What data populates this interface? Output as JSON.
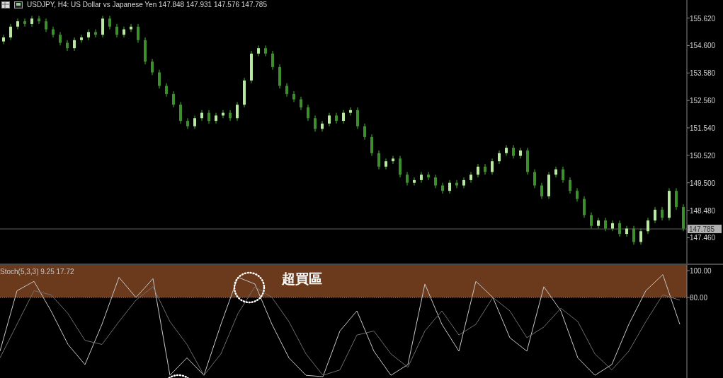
{
  "chart_window": {
    "symbol_info": "USDJPY, H4:  US Dollar vs Japanese Yen  147.848 147.931 147.576 147.785"
  },
  "price_chart": {
    "chart_data": {
      "type": "candlestick",
      "ylim": [
        146.5,
        156.29
      ],
      "yticks": [
        {
          "value": 155.62,
          "label": "155.620"
        },
        {
          "value": 154.6,
          "label": "154.600"
        },
        {
          "value": 153.58,
          "label": "153.580"
        },
        {
          "value": 152.56,
          "label": "152.560"
        },
        {
          "value": 151.54,
          "label": "151.540"
        },
        {
          "value": 150.52,
          "label": "150.520"
        },
        {
          "value": 149.5,
          "label": "149.500"
        },
        {
          "value": 148.48,
          "label": "148.480"
        },
        {
          "value": 147.46,
          "label": "147.460"
        }
      ],
      "ref_lines": [
        {
          "axis": "y",
          "value": 147.785,
          "label": "147.785"
        }
      ],
      "ohlc": [
        [
          154.75,
          155.0,
          154.65,
          154.9
        ],
        [
          154.9,
          155.4,
          154.8,
          155.3
        ],
        [
          155.3,
          155.6,
          155.2,
          155.5
        ],
        [
          155.5,
          155.6,
          155.3,
          155.4
        ],
        [
          155.4,
          155.7,
          155.3,
          155.6
        ],
        [
          155.6,
          155.7,
          155.4,
          155.5
        ],
        [
          155.5,
          155.6,
          155.1,
          155.2
        ],
        [
          155.2,
          155.3,
          154.9,
          155.0
        ],
        [
          155.0,
          155.1,
          154.6,
          154.7
        ],
        [
          154.7,
          154.8,
          154.4,
          154.5
        ],
        [
          154.5,
          154.9,
          154.4,
          154.8
        ],
        [
          154.8,
          155.0,
          154.7,
          154.9
        ],
        [
          154.9,
          155.2,
          154.8,
          155.1
        ],
        [
          155.1,
          155.2,
          154.9,
          155.0
        ],
        [
          155.0,
          155.7,
          154.9,
          155.6
        ],
        [
          155.6,
          155.7,
          155.2,
          155.3
        ],
        [
          155.3,
          155.4,
          154.9,
          155.0
        ],
        [
          155.0,
          155.3,
          154.9,
          155.2
        ],
        [
          155.2,
          155.4,
          155.1,
          155.3
        ],
        [
          155.3,
          155.4,
          154.7,
          154.8
        ],
        [
          154.8,
          154.9,
          153.9,
          154.0
        ],
        [
          154.0,
          154.1,
          153.5,
          153.6
        ],
        [
          153.6,
          153.7,
          153.0,
          153.1
        ],
        [
          153.1,
          153.2,
          152.7,
          152.8
        ],
        [
          152.8,
          152.9,
          152.3,
          152.4
        ],
        [
          152.4,
          152.5,
          151.7,
          151.8
        ],
        [
          151.8,
          151.9,
          151.5,
          151.6
        ],
        [
          151.6,
          152.0,
          151.5,
          151.9
        ],
        [
          151.9,
          152.2,
          151.8,
          152.1
        ],
        [
          152.1,
          152.2,
          151.7,
          151.8
        ],
        [
          151.8,
          152.1,
          151.7,
          152.0
        ],
        [
          152.0,
          152.2,
          151.9,
          152.1
        ],
        [
          152.1,
          152.2,
          151.8,
          151.9
        ],
        [
          151.9,
          152.5,
          151.8,
          152.4
        ],
        [
          152.4,
          153.4,
          152.3,
          153.3
        ],
        [
          153.3,
          154.4,
          153.2,
          154.3
        ],
        [
          154.3,
          154.6,
          154.2,
          154.5
        ],
        [
          154.5,
          154.6,
          154.2,
          154.3
        ],
        [
          154.3,
          154.4,
          153.7,
          153.8
        ],
        [
          153.8,
          153.9,
          153.0,
          153.1
        ],
        [
          153.1,
          153.2,
          152.7,
          152.8
        ],
        [
          152.8,
          152.9,
          152.5,
          152.6
        ],
        [
          152.6,
          152.7,
          152.2,
          152.3
        ],
        [
          152.3,
          152.4,
          151.8,
          151.9
        ],
        [
          151.9,
          152.0,
          151.4,
          151.5
        ],
        [
          151.5,
          151.8,
          151.4,
          151.7
        ],
        [
          151.7,
          152.1,
          151.6,
          152.0
        ],
        [
          152.0,
          152.1,
          151.7,
          151.8
        ],
        [
          151.8,
          152.2,
          151.7,
          152.1
        ],
        [
          152.1,
          152.3,
          152.0,
          152.2
        ],
        [
          152.2,
          152.3,
          151.5,
          151.6
        ],
        [
          151.6,
          151.7,
          151.1,
          151.2
        ],
        [
          151.2,
          151.3,
          150.5,
          150.6
        ],
        [
          150.6,
          150.7,
          150.0,
          150.1
        ],
        [
          150.1,
          150.4,
          150.0,
          150.3
        ],
        [
          150.3,
          150.5,
          150.2,
          150.4
        ],
        [
          150.4,
          150.5,
          149.7,
          149.8
        ],
        [
          149.8,
          149.9,
          149.4,
          149.5
        ],
        [
          149.5,
          149.7,
          149.4,
          149.6
        ],
        [
          149.6,
          149.9,
          149.5,
          149.8
        ],
        [
          149.8,
          149.9,
          149.6,
          149.7
        ],
        [
          149.7,
          149.8,
          149.3,
          149.4
        ],
        [
          149.4,
          149.5,
          149.1,
          149.2
        ],
        [
          149.2,
          149.6,
          149.1,
          149.5
        ],
        [
          149.5,
          149.6,
          149.3,
          149.4
        ],
        [
          149.4,
          149.7,
          149.3,
          149.6
        ],
        [
          149.6,
          149.9,
          149.5,
          149.8
        ],
        [
          149.8,
          150.2,
          149.7,
          150.1
        ],
        [
          150.1,
          150.2,
          149.8,
          149.9
        ],
        [
          149.9,
          150.4,
          149.8,
          150.3
        ],
        [
          150.3,
          150.7,
          150.2,
          150.6
        ],
        [
          150.6,
          150.9,
          150.5,
          150.8
        ],
        [
          150.8,
          150.9,
          150.4,
          150.5
        ],
        [
          150.5,
          150.8,
          150.4,
          150.7
        ],
        [
          150.7,
          150.8,
          149.8,
          149.9
        ],
        [
          149.9,
          150.0,
          149.3,
          149.4
        ],
        [
          149.4,
          149.5,
          148.9,
          149.0
        ],
        [
          149.0,
          149.9,
          148.9,
          149.8
        ],
        [
          149.8,
          150.1,
          149.7,
          150.0
        ],
        [
          150.0,
          150.1,
          149.5,
          149.6
        ],
        [
          149.6,
          149.7,
          149.1,
          149.2
        ],
        [
          149.2,
          149.3,
          148.8,
          148.9
        ],
        [
          148.9,
          149.0,
          148.2,
          148.3
        ],
        [
          148.3,
          148.4,
          147.8,
          147.9
        ],
        [
          147.9,
          148.2,
          147.8,
          148.1
        ],
        [
          148.1,
          148.2,
          147.7,
          147.8
        ],
        [
          147.8,
          148.1,
          147.7,
          148.0
        ],
        [
          148.0,
          148.1,
          147.5,
          147.6
        ],
        [
          147.6,
          147.9,
          147.5,
          147.8
        ],
        [
          147.8,
          147.9,
          147.2,
          147.3
        ],
        [
          147.3,
          147.8,
          147.2,
          147.7
        ],
        [
          147.7,
          148.2,
          147.6,
          148.1
        ],
        [
          148.1,
          148.6,
          148.0,
          148.5
        ],
        [
          148.5,
          148.6,
          148.1,
          148.2
        ],
        [
          148.2,
          149.3,
          148.1,
          149.2
        ],
        [
          149.2,
          149.3,
          148.5,
          148.6
        ],
        [
          148.6,
          148.7,
          147.7,
          147.8
        ]
      ]
    }
  },
  "stochastic": {
    "label": "Stoch(5,3,3) 9.25 17.72",
    "chart_data": {
      "type": "line",
      "ylim": [
        20,
        104.2
      ],
      "yticks": [
        {
          "value": 100,
          "label": "100.00"
        },
        {
          "value": 80,
          "label": "80.00"
        }
      ],
      "bands": [
        {
          "axis": "y",
          "from": 80,
          "to": 104.2,
          "color": "#6b3a1c"
        }
      ],
      "series": [
        {
          "color": "#c8c8c8",
          "values": [
            40,
            85,
            92,
            70,
            45,
            30,
            60,
            95,
            80,
            94,
            22,
            35,
            22,
            60,
            95,
            90,
            60,
            35,
            22,
            21,
            55,
            70,
            40,
            22,
            30,
            90,
            60,
            40,
            92,
            80,
            50,
            40,
            88,
            70,
            35,
            22,
            30,
            60,
            85,
            97,
            60
          ]
        },
        {
          "color": "#6e6e6e",
          "values": [
            35,
            60,
            85,
            82,
            68,
            48,
            45,
            62,
            78,
            88,
            62,
            45,
            22,
            38,
            68,
            88,
            80,
            62,
            38,
            22,
            26,
            52,
            55,
            38,
            28,
            55,
            70,
            52,
            60,
            80,
            70,
            50,
            58,
            72,
            62,
            38,
            26,
            40,
            62,
            82,
            78
          ]
        }
      ],
      "annotations": [
        "超買區"
      ]
    }
  }
}
